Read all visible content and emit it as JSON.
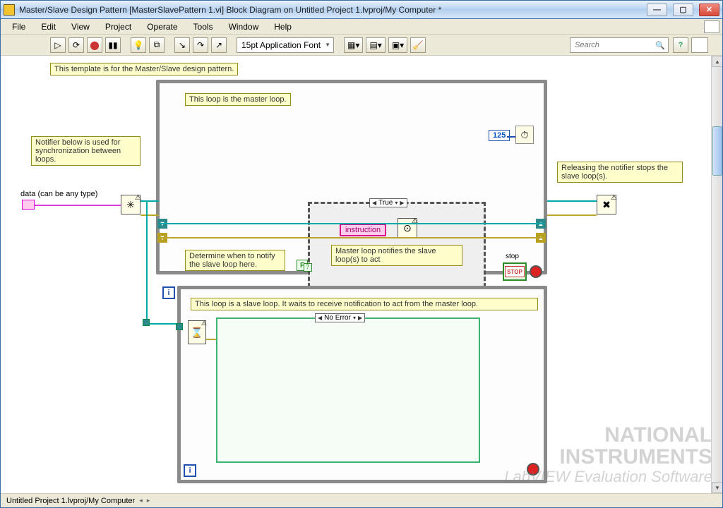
{
  "window": {
    "title": "Master/Slave Design Pattern [MasterSlavePattern 1.vi] Block Diagram on Untitled Project 1.lvproj/My Computer *"
  },
  "menus": [
    "File",
    "Edit",
    "View",
    "Project",
    "Operate",
    "Tools",
    "Window",
    "Help"
  ],
  "toolbar": {
    "font_dropdown": "15pt Application Font",
    "search_placeholder": "Search"
  },
  "statusbar": {
    "path": "Untitled Project 1.lvproj/My Computer"
  },
  "labels": {
    "template_desc": "This template is for the Master/Slave design pattern.",
    "notifier_desc": "Notifier below is used for synchronization between loops.",
    "data_type": "data (can be any type)",
    "master_loop": "This loop is the master loop.",
    "release_notifier": "Releasing the notifier stops the slave loop(s).",
    "determine_notify": "Determine when to notify the slave loop here.",
    "master_notifies": "Master loop notifies the slave loop(s) to act",
    "instruction": "instruction",
    "stop_label": "stop",
    "stop_btn": "STOP",
    "slave_loop": "This loop is a slave loop. It waits to receive notification to act from the master loop."
  },
  "constants": {
    "loop_delay": "125",
    "bool_false": "F"
  },
  "case_selectors": {
    "master_case": "True",
    "slave_case": "No Error"
  },
  "watermark": {
    "brand1": "NATIONAL",
    "brand2": "INSTRUMENTS",
    "product": "LabVIEW",
    "edition": "Evaluation Software"
  }
}
